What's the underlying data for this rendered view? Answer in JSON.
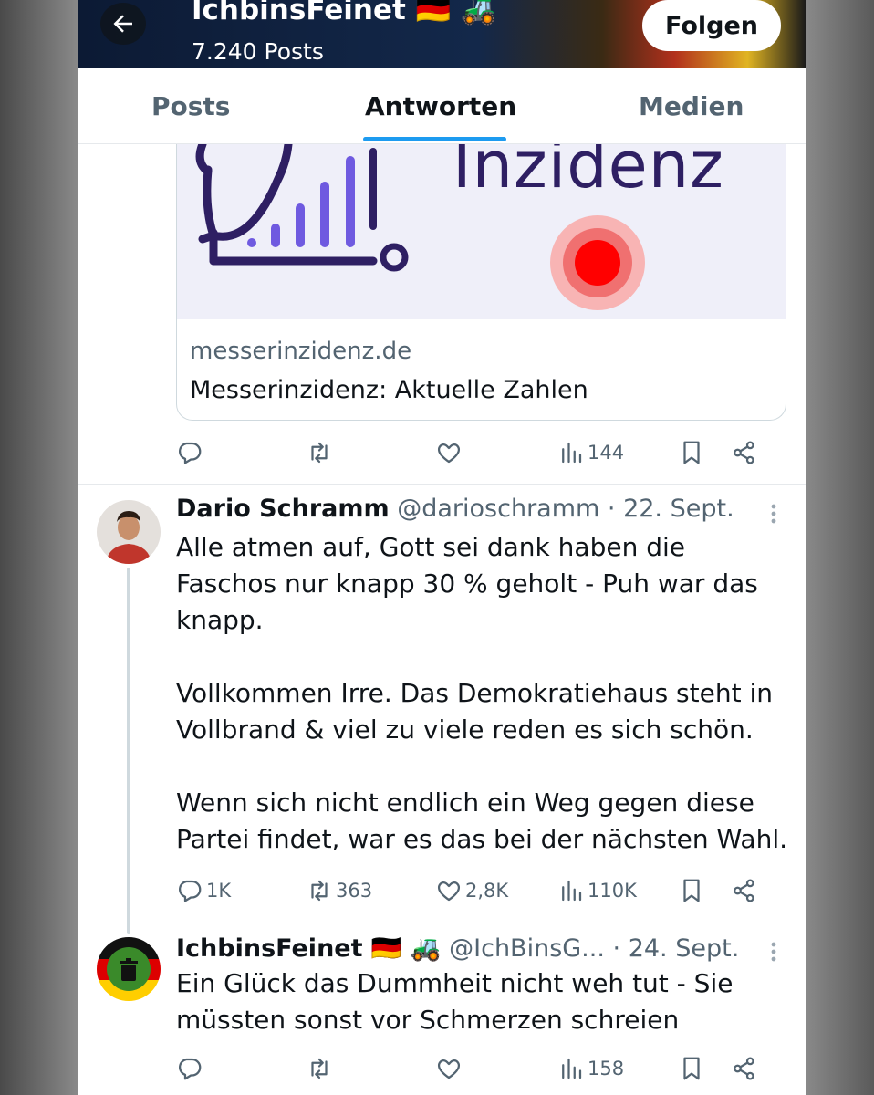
{
  "header": {
    "account_name": "IchbinsFeinet 🇩🇪 🚜",
    "post_count": "7.240 Posts",
    "follow_label": "Folgen"
  },
  "tabs": [
    "Posts",
    "Antworten",
    "Medien"
  ],
  "active_tab": "Antworten",
  "link_card": {
    "image_title": "Inzidenz",
    "domain": "messerinzidenz.de",
    "title": "Messerinzidenz: Aktuelle Zahlen"
  },
  "post1_actions": {
    "views": "144"
  },
  "tweet1": {
    "name": "Dario Schramm",
    "handle": "@darioschramm",
    "date": "· 22. Sept.",
    "text": "Alle atmen auf, Gott sei dank haben die Faschos nur knapp 30 % geholt - Puh war das knapp.\n\nVollkommen Irre. Das Demokratiehaus steht in Vollbrand & viel zu viele reden es sich schön.\n\nWenn sich nicht endlich ein Weg gegen diese Partei findet, war es das bei der nächsten Wahl.",
    "replies": "1K",
    "reposts": "363",
    "likes": "2,8K",
    "views": "110K"
  },
  "tweet2": {
    "name": "IchbinsFeinet 🇩🇪 🚜",
    "handle": "@IchBinsG...",
    "date": "· 24. Sept.",
    "text": "Ein Glück das Dummheit nicht weh tut - Sie müssten sonst vor Schmerzen schreien",
    "views": "158"
  },
  "colors": {
    "accent": "#1d9bf0",
    "text": "#0f1419",
    "secondary": "#536471"
  }
}
